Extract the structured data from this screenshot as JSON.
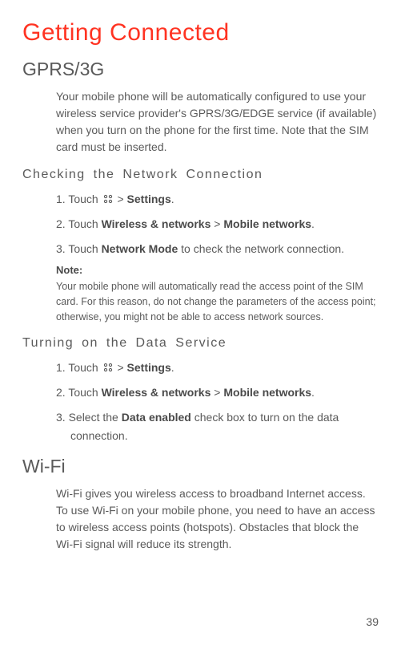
{
  "title": "Getting Connected",
  "gprs": {
    "heading": "GPRS/3G",
    "intro": "Your mobile phone will be automatically configured to use your wireless service provider's GPRS/3G/EDGE service (if available) when you turn on the phone for the first time. Note that the SIM card must be inserted."
  },
  "check": {
    "heading": "Checking the Network Connection",
    "s1a": "1. Touch ",
    "s1b": " > ",
    "s1c": ".",
    "settings": "Settings",
    "s2a": "2. Touch ",
    "wireless": "Wireless & networks",
    "s2b": " > ",
    "mobile": "Mobile networks",
    "s2c": ".",
    "s3a": "3. Touch ",
    "netmode": "Network Mode",
    "s3b": " to check the network connection.",
    "note_label": "Note:",
    "note_text": "Your mobile phone will automatically read the access point of the SIM card. For this reason, do not change the parameters of the access point; otherwise, you might not be able to access network sources."
  },
  "data": {
    "heading": "Turning on the Data Service",
    "s1a": "1. Touch ",
    "s1b": " > ",
    "s1c": ".",
    "settings": "Settings",
    "s2a": "2. Touch ",
    "wireless": "Wireless & networks",
    "s2b": " > ",
    "mobile": "Mobile networks",
    "s2c": ".",
    "s3a": "3. Select the ",
    "enabled": "Data enabled",
    "s3b": " check box to turn on the data",
    "s3c": "connection."
  },
  "wifi": {
    "heading": "Wi-Fi",
    "intro": "Wi-Fi gives you wireless access to broadband Internet access. To use Wi-Fi on your mobile phone, you need to have an access to wireless access points (hotspots). Obstacles that block the Wi-Fi signal will reduce its strength."
  },
  "page_number": "39"
}
